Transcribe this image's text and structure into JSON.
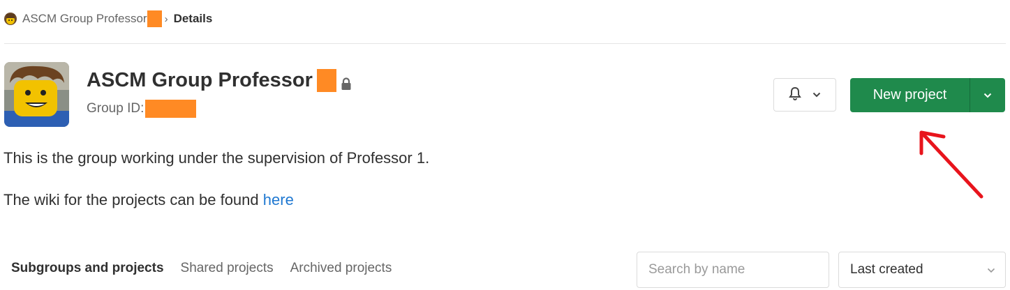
{
  "breadcrumb": {
    "group": "ASCM Group Professor",
    "separator": "›",
    "current": "Details"
  },
  "group": {
    "name": "ASCM Group Professor",
    "id_label": "Group ID:",
    "lock_icon": "lock-icon"
  },
  "actions": {
    "notifications_icon": "bell-icon",
    "new_project_label": "New project"
  },
  "description": {
    "line1": "This is the group working under the supervision of Professor 1.",
    "line2_prefix": "The wiki for the projects can be found ",
    "line2_link": "here"
  },
  "tabs": [
    {
      "label": "Subgroups and projects",
      "active": true
    },
    {
      "label": "Shared projects",
      "active": false
    },
    {
      "label": "Archived projects",
      "active": false
    }
  ],
  "search": {
    "placeholder": "Search by name"
  },
  "sort": {
    "selected": "Last created"
  },
  "colors": {
    "primary_green": "#1f8a4c",
    "link_blue": "#1f78d1",
    "redaction": "#ff8a24",
    "annotation_arrow": "#e8141c"
  }
}
